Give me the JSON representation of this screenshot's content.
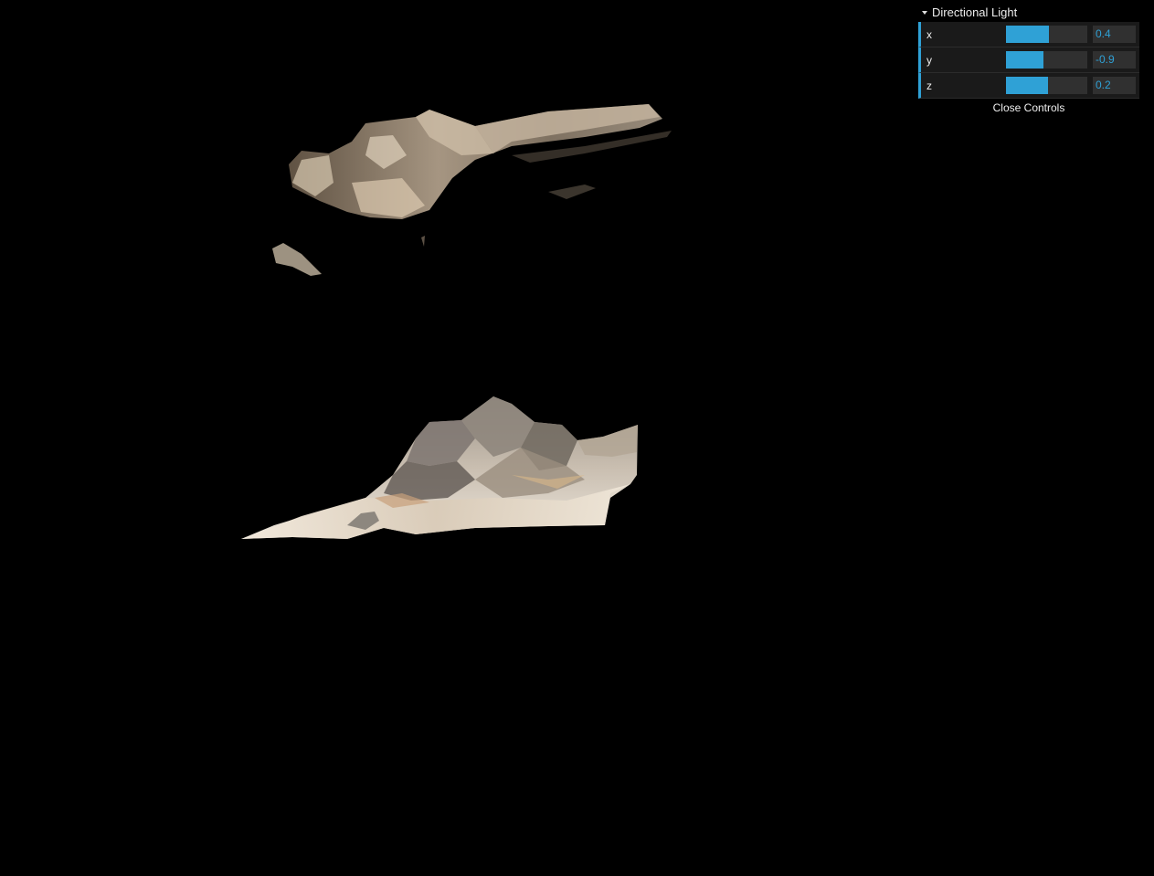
{
  "gui": {
    "folder_title": "Directional Light",
    "close_label": "Close Controls",
    "accent_color": "#2fa1d6",
    "controllers": [
      {
        "label": "x",
        "value": "0.4",
        "fill": 0.53
      },
      {
        "label": "y",
        "value": "-0.9",
        "fill": 0.46
      },
      {
        "label": "z",
        "value": "0.2",
        "fill": 0.52
      }
    ]
  },
  "scene": {
    "background_color": "#000000"
  }
}
